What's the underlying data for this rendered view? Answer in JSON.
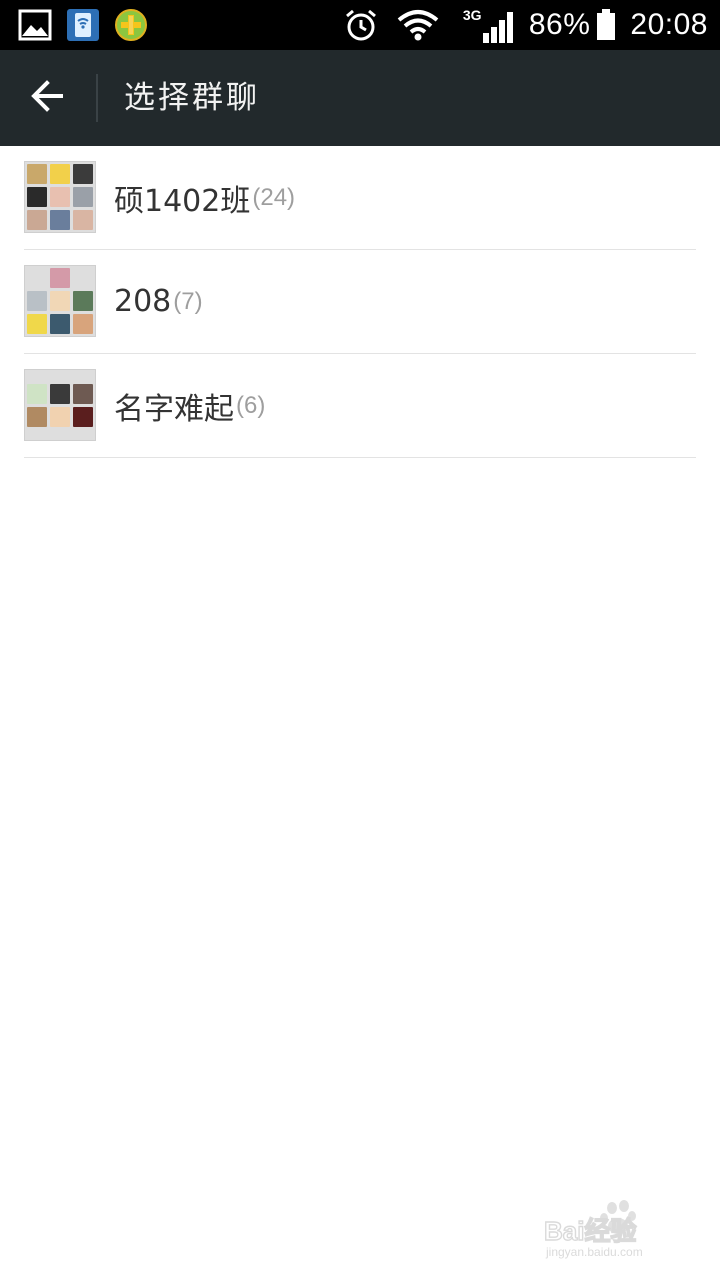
{
  "status_bar": {
    "left_icons": [
      "gallery-icon",
      "wifi-transfer-app-icon",
      "health-plus-app-icon"
    ],
    "right_icons": [
      "alarm-icon",
      "wifi-icon",
      "signal-3g-icon",
      "battery-icon"
    ],
    "network": "3G",
    "battery": "86%",
    "time": "20:08"
  },
  "action_bar": {
    "back_icon": "arrow-left-icon",
    "title": "选择群聊",
    "background": "#22292c"
  },
  "groups": [
    {
      "name": "硕1402班",
      "count": "(24)"
    },
    {
      "name": "208",
      "count": "(7)"
    },
    {
      "name": "名字难起",
      "count": "(6)"
    }
  ],
  "watermark": {
    "brand": "Bai经验",
    "url": "jingyan.baidu.com"
  }
}
